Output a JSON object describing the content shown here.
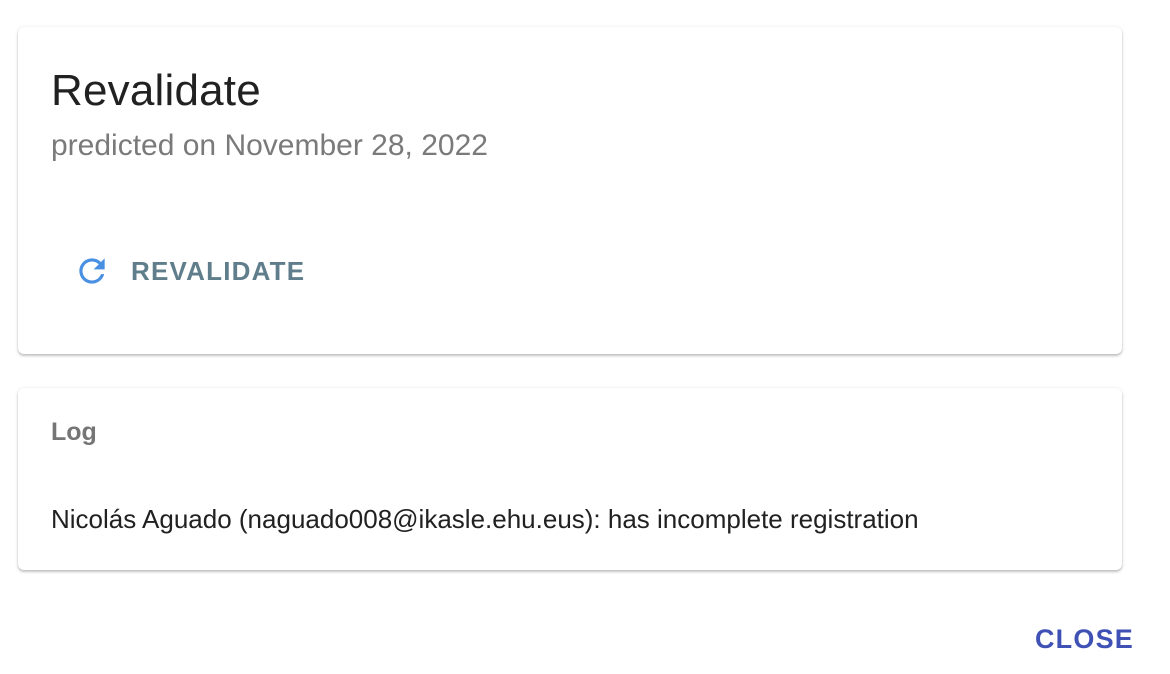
{
  "revalidate_card": {
    "title": "Revalidate",
    "subtitle": "predicted on November 28, 2022",
    "button": {
      "icon": "refresh-icon",
      "label": "REVALIDATE",
      "icon_color": "#4a90e2",
      "label_color": "#607d8b"
    }
  },
  "log_card": {
    "heading": "Log",
    "entries": [
      "Nicolás Aguado (naguado008@ikasle.ehu.eus): has incomplete registration"
    ]
  },
  "footer": {
    "close_label": "CLOSE",
    "close_color": "#3f51b5"
  }
}
